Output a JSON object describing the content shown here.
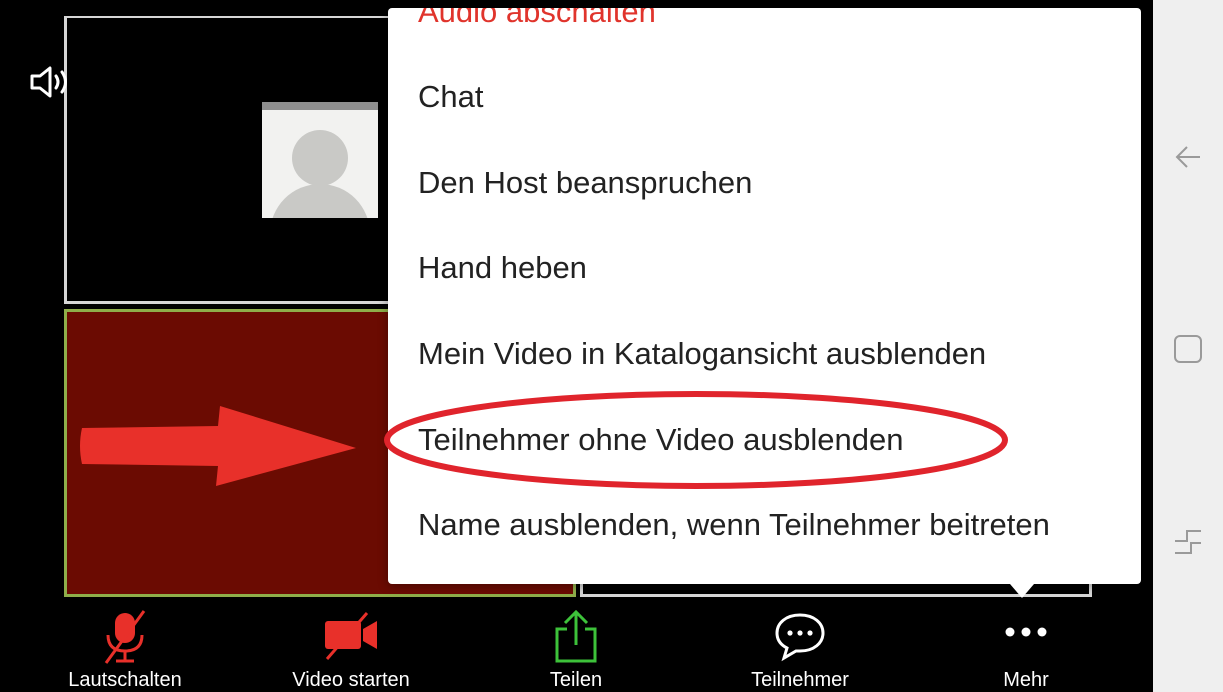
{
  "menu": {
    "items": [
      "Audio abschalten",
      "Chat",
      "Den Host beanspruchen",
      "Hand heben",
      "Mein Video in Katalogansicht ausblenden",
      "Teilnehmer ohne Video ausblenden",
      "Name ausblenden, wenn Teilnehmer beitreten"
    ],
    "highlighted_index": 5
  },
  "toolbar": {
    "mute": "Lautschalten",
    "video": "Video starten",
    "share": "Teilen",
    "participants": "Teilnehmer",
    "more": "Mehr"
  },
  "icons": {
    "speaker": "speaker-icon",
    "mic_off": "mic-muted-icon",
    "camera_off": "camera-off-icon",
    "share": "share-upload-icon",
    "chat": "chat-bubble-icon",
    "more": "more-dots-icon",
    "back": "back-arrow-icon",
    "home": "home-square-icon",
    "recents": "recents-icon"
  },
  "colors": {
    "accent_red": "#e0342c",
    "share_green": "#3dc23a",
    "tile_active_border": "#8fae4a"
  }
}
